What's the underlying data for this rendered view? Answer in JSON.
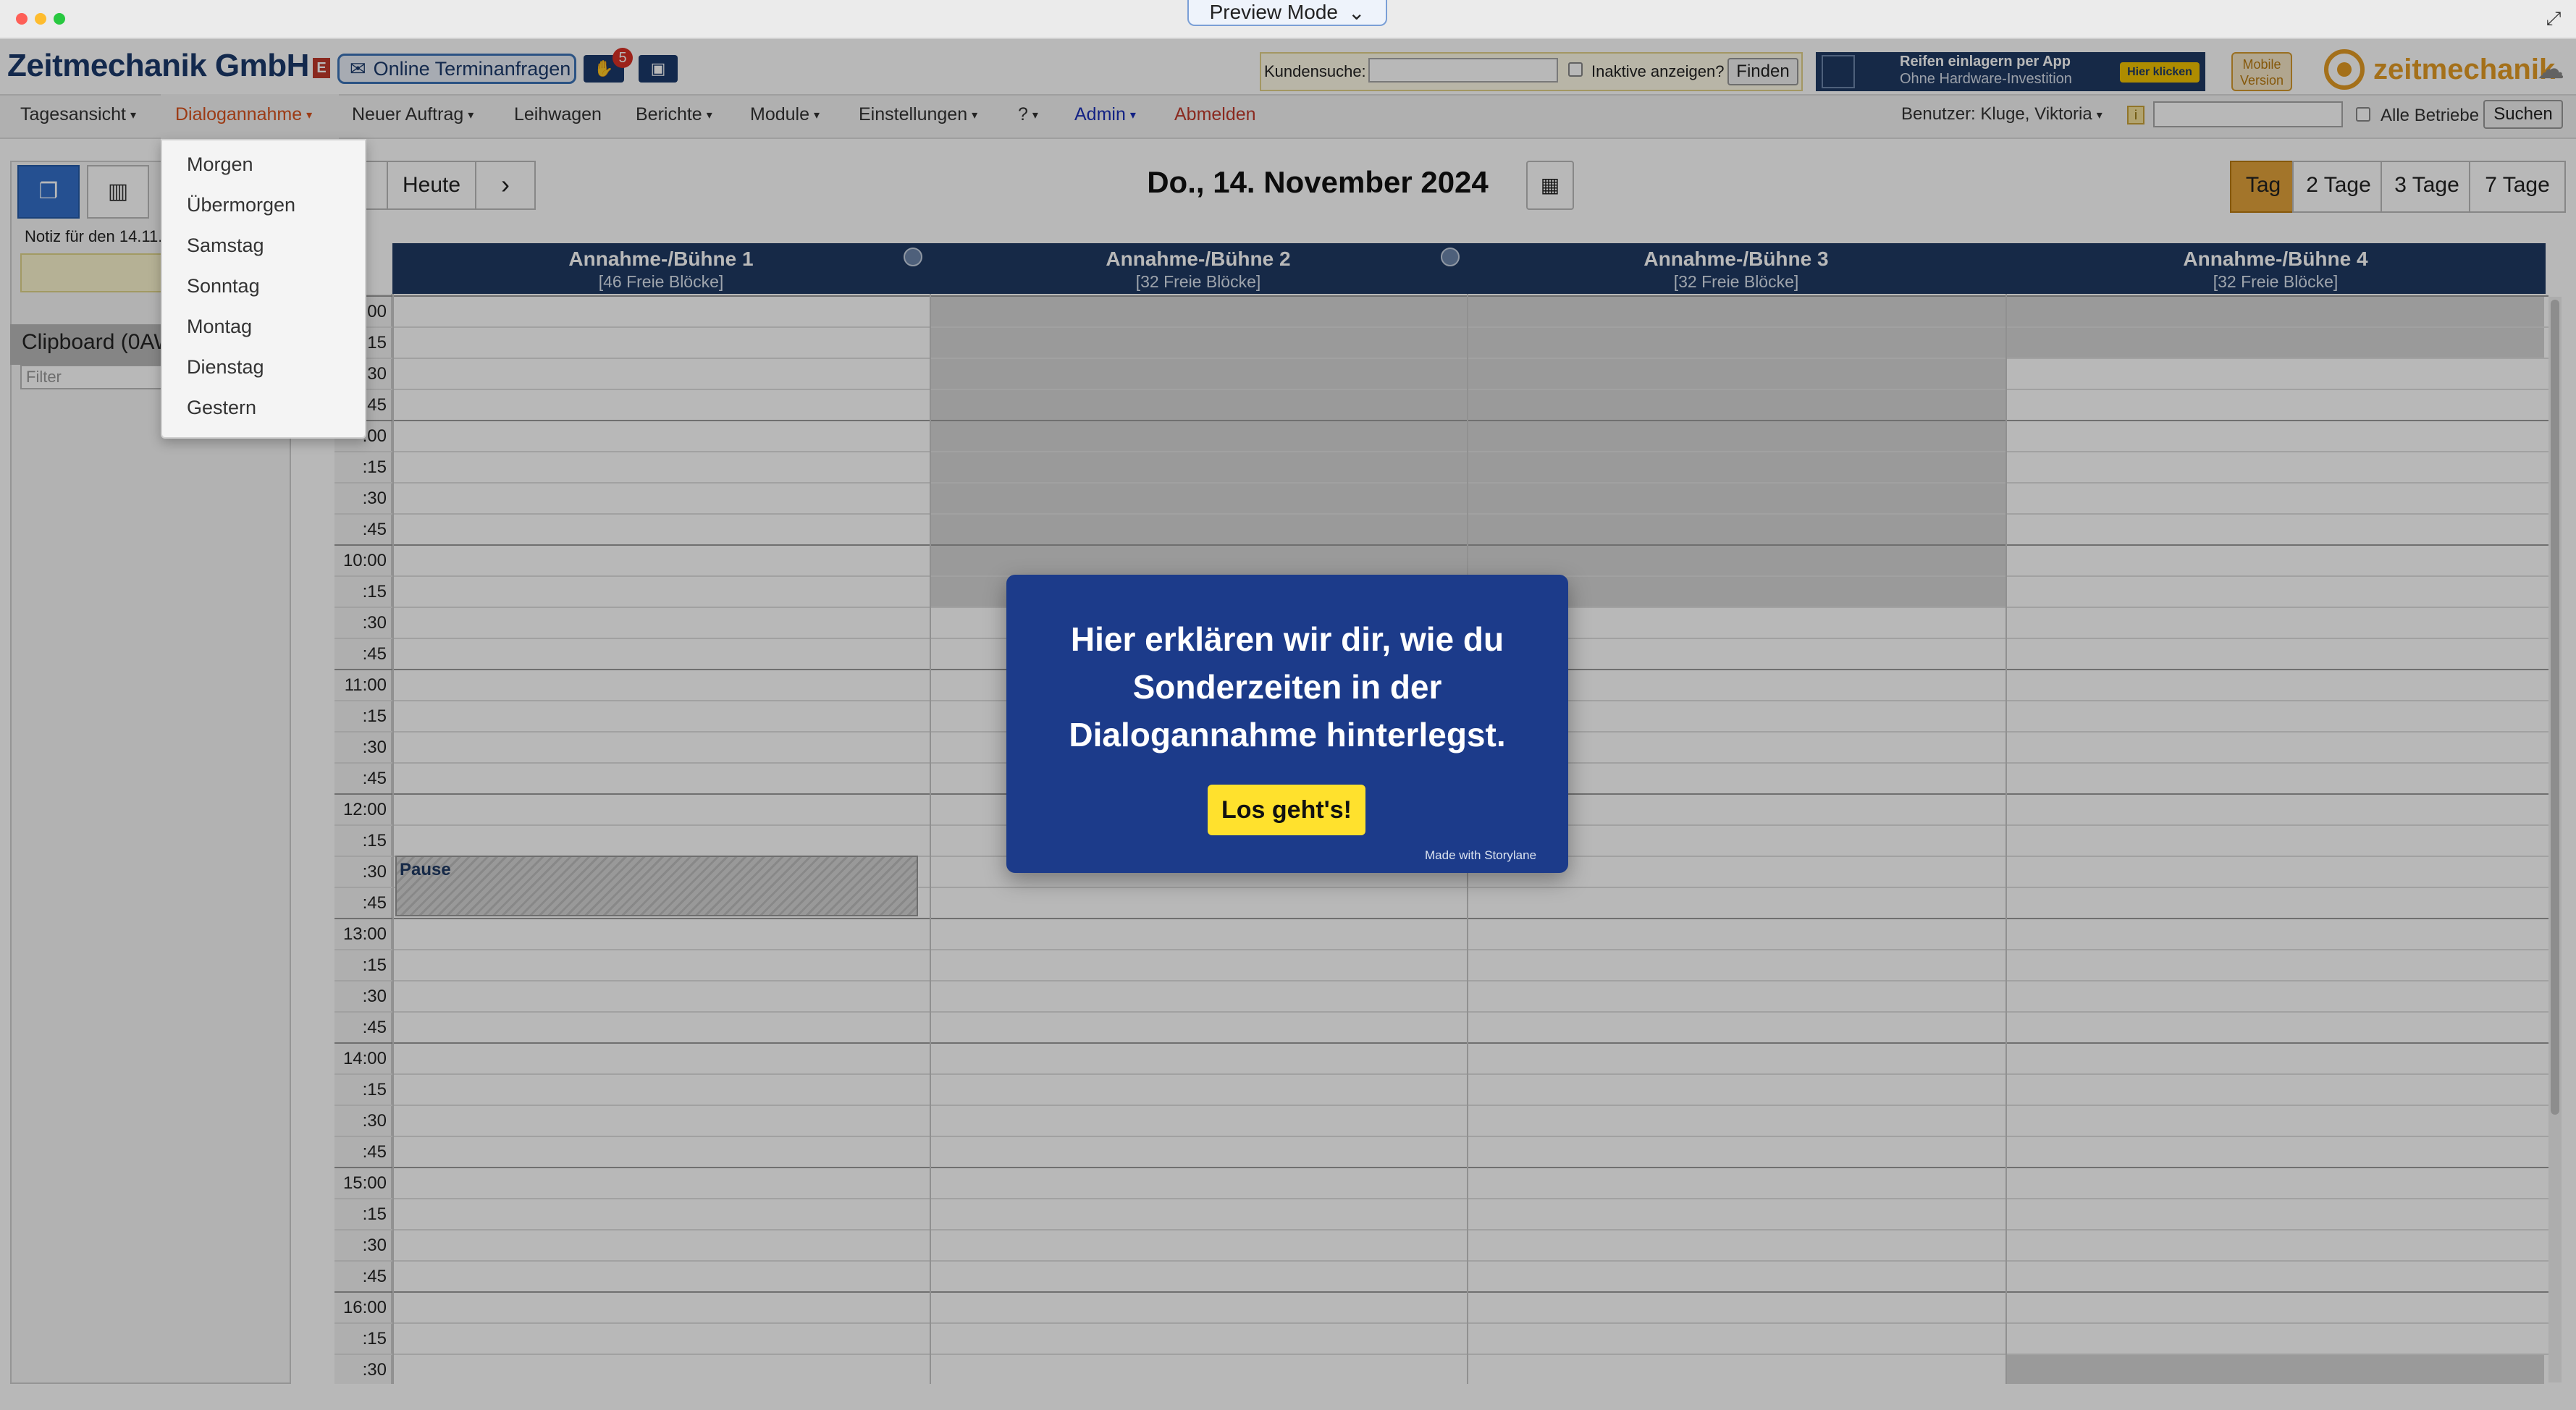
{
  "chrome": {
    "preview_label": "Preview Mode"
  },
  "header": {
    "company": "Zeitmechanik GmbH",
    "e_badge": "E",
    "online_requests": "Online Terminanfragen",
    "notification_count": "5",
    "search_label": "Kundensuche:",
    "inactive_label": "Inaktive anzeigen?",
    "find_button": "Finden",
    "banner_line1": "Reifen einlagern per App",
    "banner_line2": "Ohne Hardware-Investition",
    "banner_button": "Hier klicken",
    "mobile_line1": "Mobile",
    "mobile_line2": "Version",
    "brand": "zeitmechanik"
  },
  "nav": {
    "items": [
      "Tagesansicht",
      "Dialogannahme",
      "Neuer Auftrag",
      "Leihwagen",
      "Berichte",
      "Module",
      "Einstellungen",
      "?",
      "Admin",
      "Abmelden"
    ],
    "user": "Benutzer: Kluge, Viktoria",
    "all_label": "Alle Betriebe",
    "search_button": "Suchen"
  },
  "dropdown": {
    "items": [
      "Morgen",
      "Übermorgen",
      "Samstag",
      "Sonntag",
      "Montag",
      "Dienstag",
      "Gestern"
    ]
  },
  "left": {
    "note_label": "Notiz für den 14.11.",
    "clipboard_title": "Clipboard (0AW",
    "filter_placeholder": "Filter"
  },
  "calendar": {
    "today_button": "Heute",
    "date_title": "Do., 14. November 2024",
    "views": [
      "Tag",
      "2 Tage",
      "3 Tage",
      "7 Tage"
    ],
    "active_view": "Tag",
    "columns": [
      {
        "title": "Annahme-/Bühne 1",
        "sub": "[46 Freie Blöcke]"
      },
      {
        "title": "Annahme-/Bühne 2",
        "sub": "[32 Freie Blöcke]"
      },
      {
        "title": "Annahme-/Bühne 3",
        "sub": "[32 Freie Blöcke]"
      },
      {
        "title": "Annahme-/Bühne 4",
        "sub": "[32 Freie Blöcke]"
      }
    ],
    "time_labels": [
      ":00",
      ":15",
      ":30",
      ":45",
      ":00",
      ":15",
      ":30",
      ":45",
      "10:00",
      ":15",
      ":30",
      ":45",
      "11:00",
      ":15",
      ":30",
      ":45",
      "12:00",
      ":15",
      ":30",
      ":45",
      "13:00",
      ":15",
      ":30",
      ":45",
      "14:00",
      ":15",
      ":30",
      ":45",
      "15:00",
      ":15",
      ":30",
      ":45",
      "16:00",
      ":15",
      ":30"
    ],
    "pause_label": "Pause"
  },
  "modal": {
    "text": "Hier erklären wir dir, wie du Sonderzeiten in der Dialogannahme hinterlegst.",
    "button": "Los geht's!",
    "credit": "Made with Storylane"
  },
  "colors": {
    "navy": "#1f3a63",
    "accent_orange": "#e2a23b",
    "modal_bg": "#1c3b8a",
    "modal_button": "#ffe12d"
  }
}
